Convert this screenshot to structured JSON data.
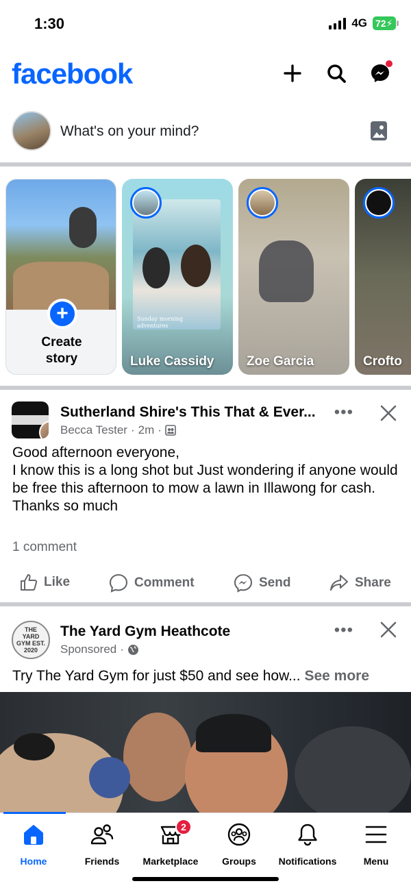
{
  "status_bar": {
    "time": "1:30",
    "network": "4G",
    "battery": "72"
  },
  "header": {
    "logo": "facebook",
    "icons": [
      "plus-icon",
      "search-icon",
      "messenger-icon"
    ],
    "accent": "#0866ff",
    "notification_dot_color": "#e41e3f"
  },
  "composer": {
    "placeholder": "What's on your mind?"
  },
  "stories": {
    "create": {
      "label": "Create story"
    },
    "items": [
      {
        "name": "Luke Cassidy",
        "caption": "Sunday morning adventures"
      },
      {
        "name": "Zoe Garcia"
      },
      {
        "name": "Crofto"
      }
    ]
  },
  "post1": {
    "group": "Sutherland Shire's This That & Ever...",
    "author": "Becca Tester",
    "time": "2m",
    "body": [
      "Good afternoon everyone,",
      "I know this is a long shot but Just wondering if anyone would be free this afternoon to mow a lawn in Illawong for cash.",
      "Thanks so much"
    ],
    "comments": "1 comment",
    "actions": {
      "like": "Like",
      "comment": "Comment",
      "send": "Send",
      "share": "Share"
    }
  },
  "post2": {
    "page": "The Yard Gym Heathcote",
    "sponsored": "Sponsored",
    "avatar_text": "THE YARD GYM EST. 2020",
    "body": "Try The Yard Gym for just $50 and see how...",
    "see_more": "See more"
  },
  "tabbar": {
    "tabs": [
      {
        "label": "Home",
        "active": true
      },
      {
        "label": "Friends"
      },
      {
        "label": "Marketplace",
        "badge": "2"
      },
      {
        "label": "Groups"
      },
      {
        "label": "Notifications"
      },
      {
        "label": "Menu"
      }
    ]
  }
}
